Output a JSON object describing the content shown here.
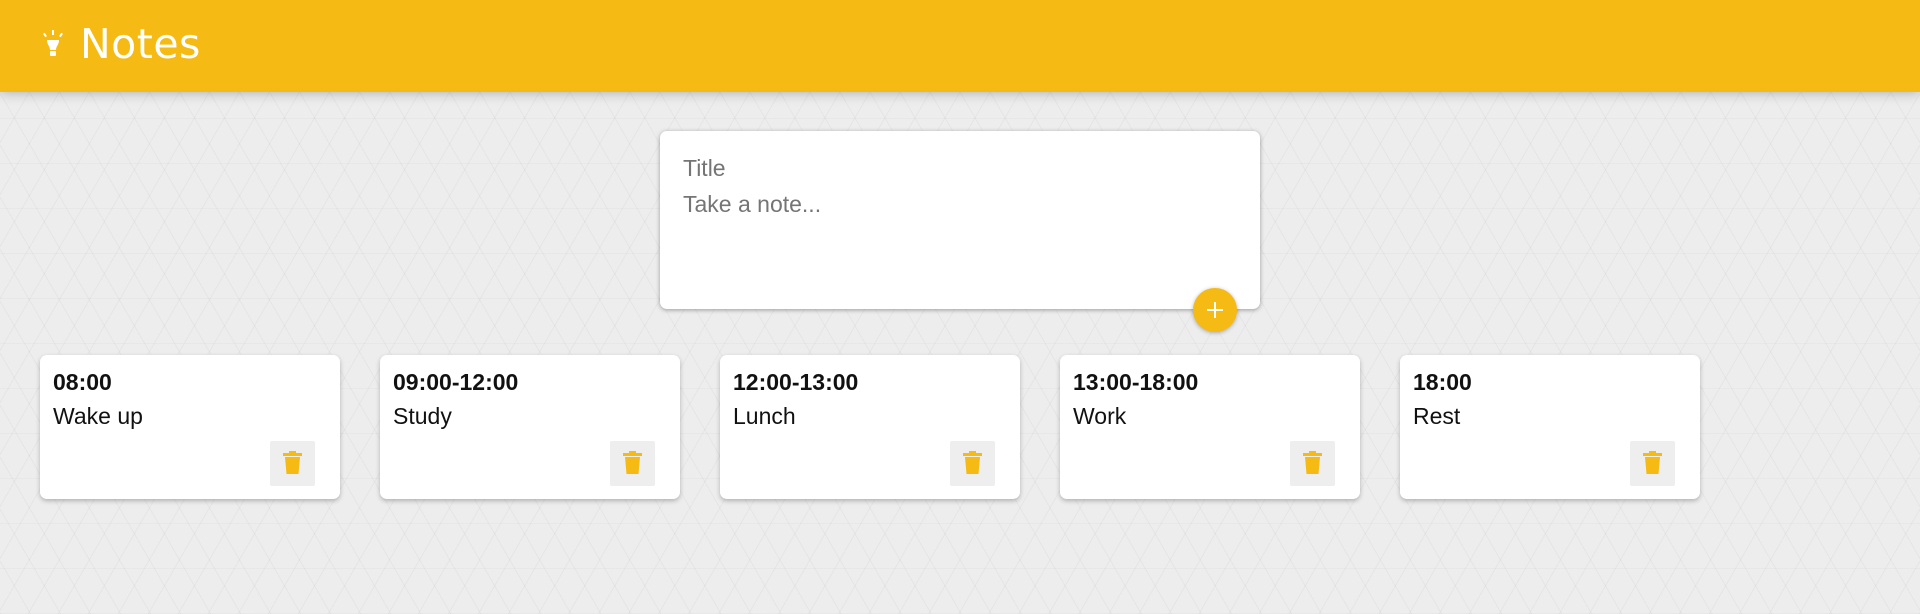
{
  "header": {
    "title": "Notes",
    "icon": "lightbulb-icon",
    "color": "#f5ba14"
  },
  "create_form": {
    "title_placeholder": "Title",
    "content_placeholder": "Take a note...",
    "add_button_icon": "plus-icon"
  },
  "notes": [
    {
      "title": "08:00",
      "content": "Wake up",
      "delete_icon": "trash-icon"
    },
    {
      "title": "09:00-12:00",
      "content": "Study",
      "delete_icon": "trash-icon"
    },
    {
      "title": "12:00-13:00",
      "content": "Lunch",
      "delete_icon": "trash-icon"
    },
    {
      "title": "13:00-18:00",
      "content": "Work",
      "delete_icon": "trash-icon"
    },
    {
      "title": "18:00",
      "content": "Rest",
      "delete_icon": "trash-icon"
    }
  ],
  "colors": {
    "accent": "#f5ba14",
    "card": "#ffffff",
    "delete_bg": "#eeeeee"
  }
}
